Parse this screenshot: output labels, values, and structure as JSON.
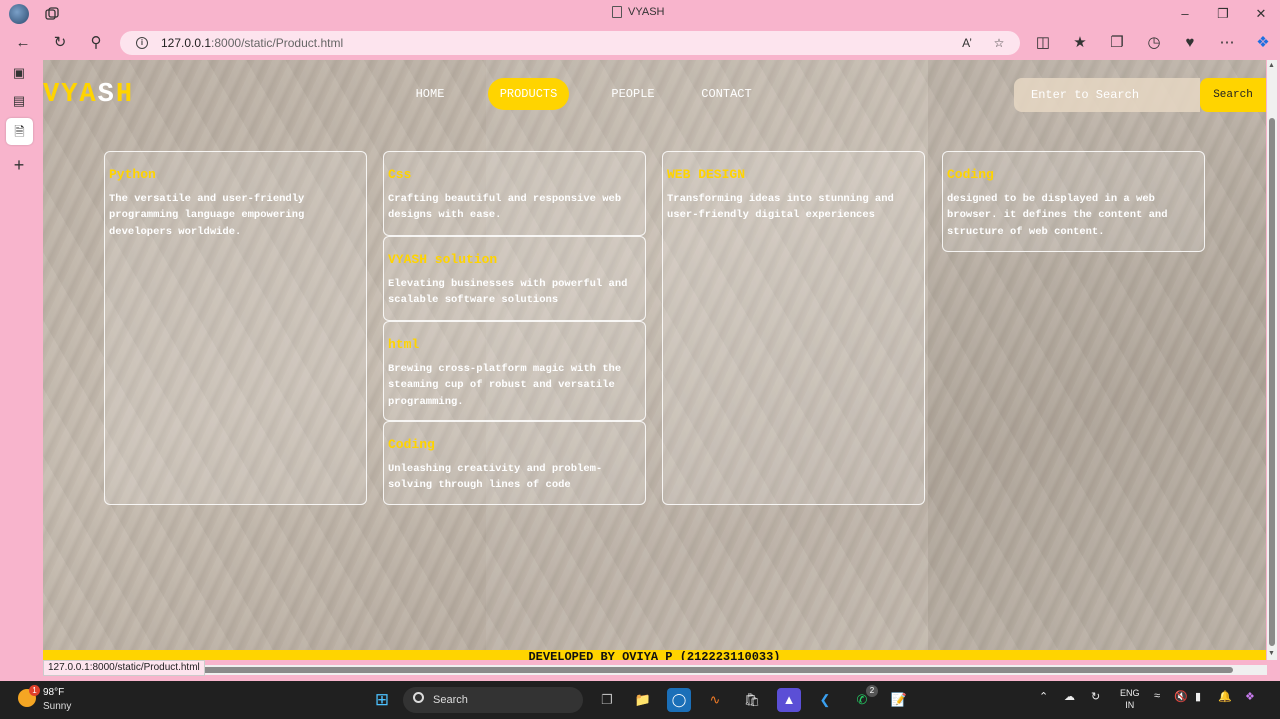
{
  "browser": {
    "tab_title": "VYASH",
    "url_host": "127.0.0.1",
    "url_rest": ":8000/static/Product.html",
    "status_url": "127.0.0.1:8000/static/Product.html"
  },
  "site": {
    "logo": [
      "V",
      "Y",
      "A",
      "S",
      "H"
    ],
    "nav": [
      {
        "label": "HOME"
      },
      {
        "label": "PRODUCTS"
      },
      {
        "label": "PEOPLE"
      },
      {
        "label": "CONTACT"
      }
    ],
    "search_placeholder": "Enter to Search",
    "search_button": "Search",
    "footer": "DEVELOPED BY OVIYA P (212223110033)"
  },
  "cards": [
    {
      "title": "Python",
      "text": "The versatile and user-friendly programming language empowering developers worldwide."
    },
    {
      "title": "Css",
      "text": "Crafting beautiful and responsive web designs with ease."
    },
    {
      "title": "VYASH solution",
      "text": "Elevating businesses with powerful and scalable software solutions"
    },
    {
      "title": "html",
      "text": "Brewing cross-platform magic with the steaming cup of robust and versatile programming."
    },
    {
      "title": "Coding",
      "text": "Unleashing creativity and problem-solving through lines of code"
    },
    {
      "title": "WEB DESIGN",
      "text": "Transforming ideas into stunning and user-friendly digital experiences"
    },
    {
      "title": "Coding",
      "text": "designed to be displayed in a web browser. it defines the content and structure of web content."
    }
  ],
  "taskbar": {
    "weather_temp": "98°F",
    "weather_cond": "Sunny",
    "weather_badge": "1",
    "search_label": "Search",
    "lang_1": "ENG",
    "lang_2": "IN",
    "whatsapp_badge": "2"
  },
  "colors": {
    "accent": "#ffd400",
    "chrome_bg": "#f8b4cc"
  }
}
